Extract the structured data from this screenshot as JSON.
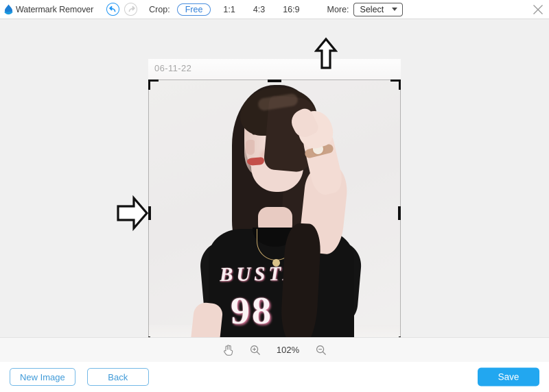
{
  "app": {
    "title": "Watermark Remover",
    "logo_icon": "water-drop-logo"
  },
  "toolbar": {
    "undo_icon": "undo-arrow-icon",
    "redo_icon": "redo-arrow-icon",
    "crop_label": "Crop:",
    "ratios": [
      {
        "label": "Free",
        "active": true
      },
      {
        "label": "1:1",
        "active": false
      },
      {
        "label": "4:3",
        "active": false
      },
      {
        "label": "16:9",
        "active": false
      }
    ],
    "more_label": "More:",
    "select_value": "Select",
    "select_caret_icon": "chevron-down-icon",
    "close_icon": "close-icon"
  },
  "canvas": {
    "watermark_date": "06-11-22",
    "shirt_text": "BUSTA",
    "shirt_number": "98",
    "annotation_right_icon": "right-arrow-annotation",
    "annotation_up_icon": "up-arrow-annotation"
  },
  "zoombar": {
    "pan_icon": "hand-pan-icon",
    "zoom_in_icon": "zoom-in-icon",
    "zoom_level": "102%",
    "zoom_out_icon": "zoom-out-icon"
  },
  "bottombar": {
    "new_image_label": "New Image",
    "back_label": "Back",
    "save_label": "Save"
  },
  "colors": {
    "accent_blue": "#22a7f0",
    "outline_blue": "#74b9e7",
    "canvas_bg": "#f0f0f0",
    "toolbar_bg": "#ffffff"
  }
}
